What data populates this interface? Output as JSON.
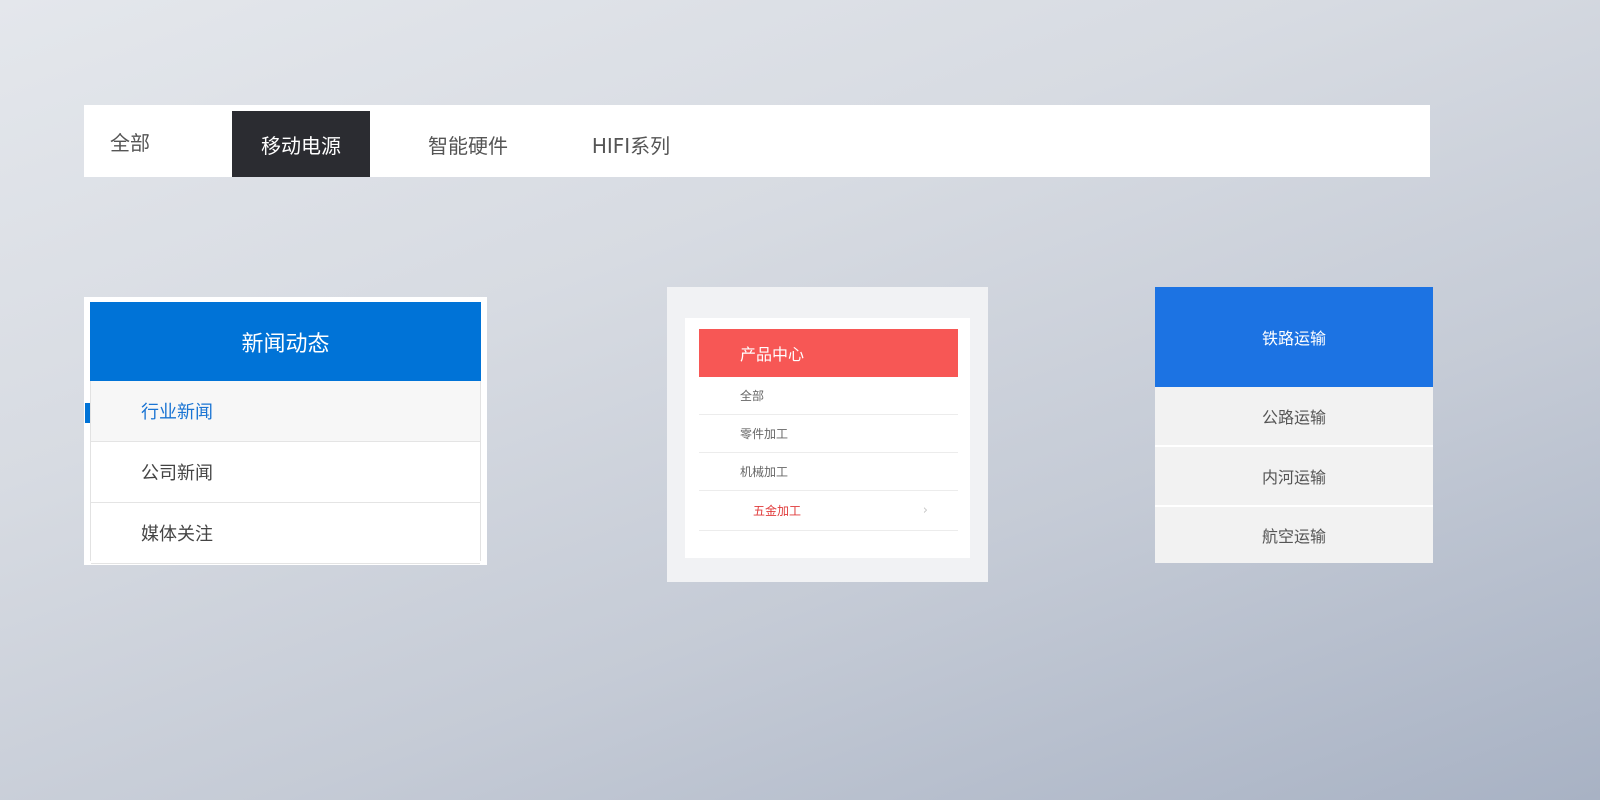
{
  "tabs": {
    "items": [
      "全部",
      "移动电源",
      "智能硬件",
      "HIFI系列"
    ],
    "active_index": 1
  },
  "news_menu": {
    "title": "新闻动态",
    "items": [
      "行业新闻",
      "公司新闻",
      "媒体关注"
    ],
    "active_index": 0
  },
  "product_menu": {
    "title": "产品中心",
    "items": [
      "全部",
      "零件加工",
      "机械加工",
      "五金加工"
    ],
    "active_index": 3,
    "chevron": "›"
  },
  "transport_menu": {
    "title": "铁路运输",
    "items": [
      "公路运输",
      "内河运输",
      "航空运输"
    ]
  },
  "colors": {
    "tab_active_bg": "#2b2c31",
    "news_header": "#0073d7",
    "product_header": "#f75755",
    "product_active_text": "#e03b3b",
    "transport_header": "#1c73e3"
  }
}
